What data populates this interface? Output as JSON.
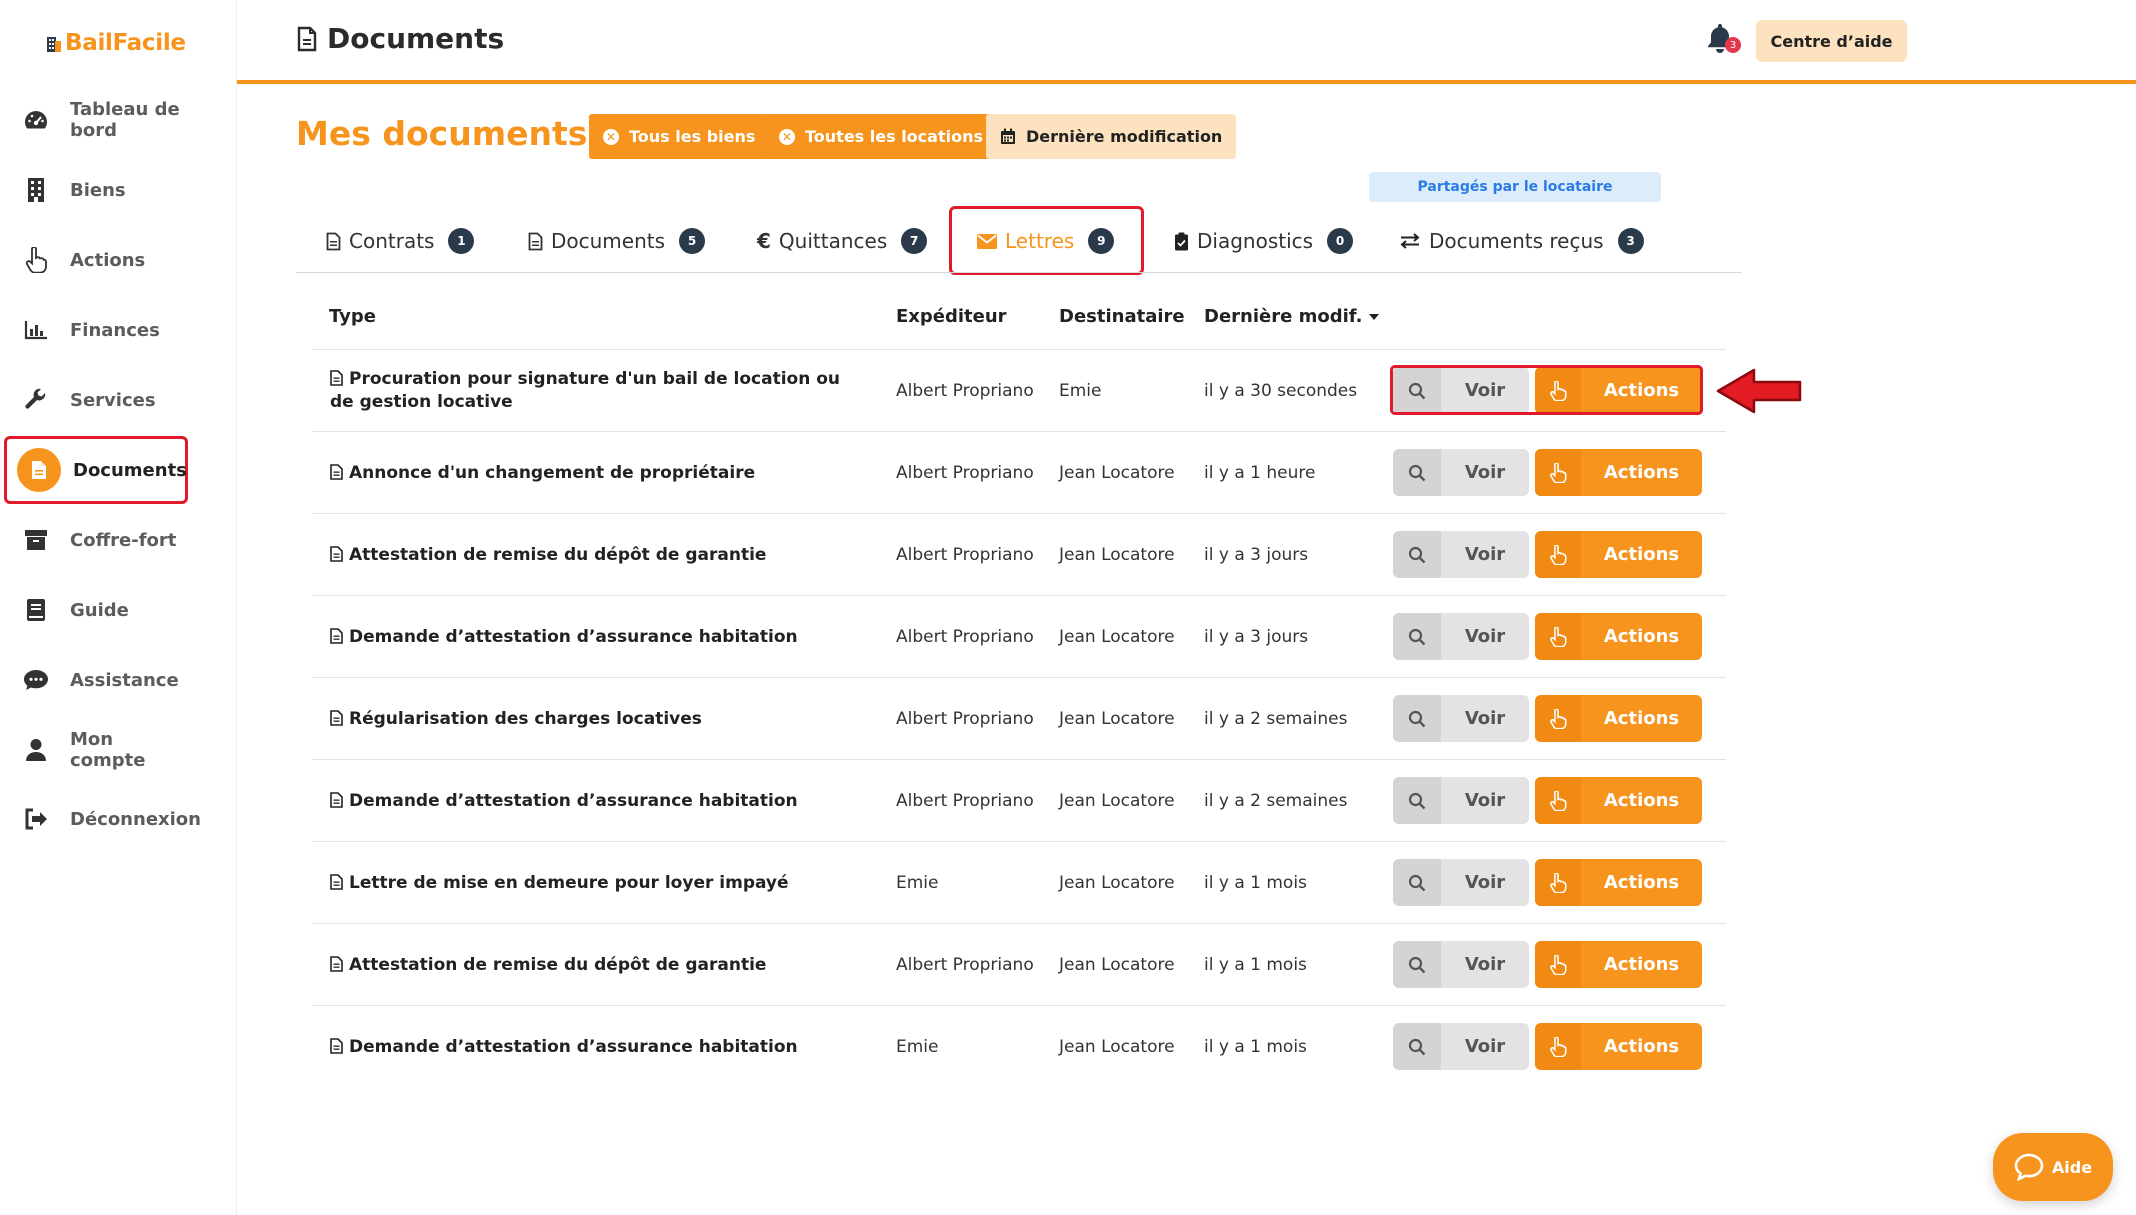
{
  "app": {
    "brand": "BailFacile",
    "brand_color": "#f7941d"
  },
  "sidebar": {
    "items": [
      {
        "label": "Tableau de bord",
        "icon": "dashboard-gauge-icon"
      },
      {
        "label": "Biens",
        "icon": "building-icon"
      },
      {
        "label": "Actions",
        "icon": "hand-pointer-icon"
      },
      {
        "label": "Finances",
        "icon": "bar-chart-icon"
      },
      {
        "label": "Services",
        "icon": "wrench-icon"
      },
      {
        "label": "Documents",
        "icon": "file-icon",
        "active": true
      },
      {
        "label": "Coffre-fort",
        "icon": "archive-box-icon"
      },
      {
        "label": "Guide",
        "icon": "book-icon"
      },
      {
        "label": "Assistance",
        "icon": "chat-bubble-icon"
      },
      {
        "label": "Mon compte",
        "icon": "user-icon"
      },
      {
        "label": "Déconnexion",
        "icon": "sign-out-icon"
      }
    ]
  },
  "header": {
    "title": "Documents",
    "help_label": "Centre d’aide",
    "notification_count": "3"
  },
  "main": {
    "heading": "Mes documents",
    "filters": [
      {
        "label": "Tous les biens",
        "style": "orange"
      },
      {
        "label": "Toutes les locations",
        "style": "orange"
      },
      {
        "label": "Dernière modification",
        "style": "beige"
      }
    ],
    "shared_label": "Partagés par le locataire",
    "tabs": [
      {
        "label": "Contrats",
        "count": "1",
        "icon": "file-icon"
      },
      {
        "label": "Documents",
        "count": "5",
        "icon": "file-icon"
      },
      {
        "label": "Quittances",
        "count": "7",
        "icon": "euro-icon"
      },
      {
        "label": "Lettres",
        "count": "9",
        "icon": "envelope-icon",
        "active": true
      },
      {
        "label": "Diagnostics",
        "count": "0",
        "icon": "clipboard-check-icon"
      },
      {
        "label": "Documents reçus",
        "count": "3",
        "icon": "exchange-icon"
      }
    ]
  },
  "table": {
    "columns": {
      "type": "Type",
      "sender": "Expéditeur",
      "recipient": "Destinataire",
      "modified": "Dernière modif."
    },
    "view_label": "Voir",
    "actions_label": "Actions",
    "rows": [
      {
        "type": "Procuration pour signature d'un bail de location ou de gestion locative",
        "sender": "Albert Propriano",
        "recipient": "Emie",
        "modified": "il y a 30 secondes"
      },
      {
        "type": "Annonce d'un changement de propriétaire",
        "sender": "Albert Propriano",
        "recipient": "Jean Locatore",
        "modified": "il y a 1 heure"
      },
      {
        "type": "Attestation de remise du dépôt de garantie",
        "sender": "Albert Propriano",
        "recipient": "Jean Locatore",
        "modified": "il y a 3 jours"
      },
      {
        "type": "Demande d’attestation d’assurance habitation",
        "sender": "Albert Propriano",
        "recipient": "Jean Locatore",
        "modified": "il y a 3 jours"
      },
      {
        "type": "Régularisation des charges locatives",
        "sender": "Albert Propriano",
        "recipient": "Jean Locatore",
        "modified": "il y a 2 semaines"
      },
      {
        "type": "Demande d’attestation d’assurance habitation",
        "sender": "Albert Propriano",
        "recipient": "Jean Locatore",
        "modified": "il y a 2 semaines"
      },
      {
        "type": "Lettre de mise en demeure pour loyer impayé",
        "sender": "Emie",
        "recipient": "Jean Locatore",
        "modified": "il y a 1 mois"
      },
      {
        "type": "Attestation de remise du dépôt de garantie",
        "sender": "Albert Propriano",
        "recipient": "Jean Locatore",
        "modified": "il y a 1 mois"
      },
      {
        "type": "Demande d’attestation d’assurance habitation",
        "sender": "Emie",
        "recipient": "Jean Locatore",
        "modified": "il y a 1 mois"
      }
    ]
  },
  "fab": {
    "label": "Aide"
  }
}
